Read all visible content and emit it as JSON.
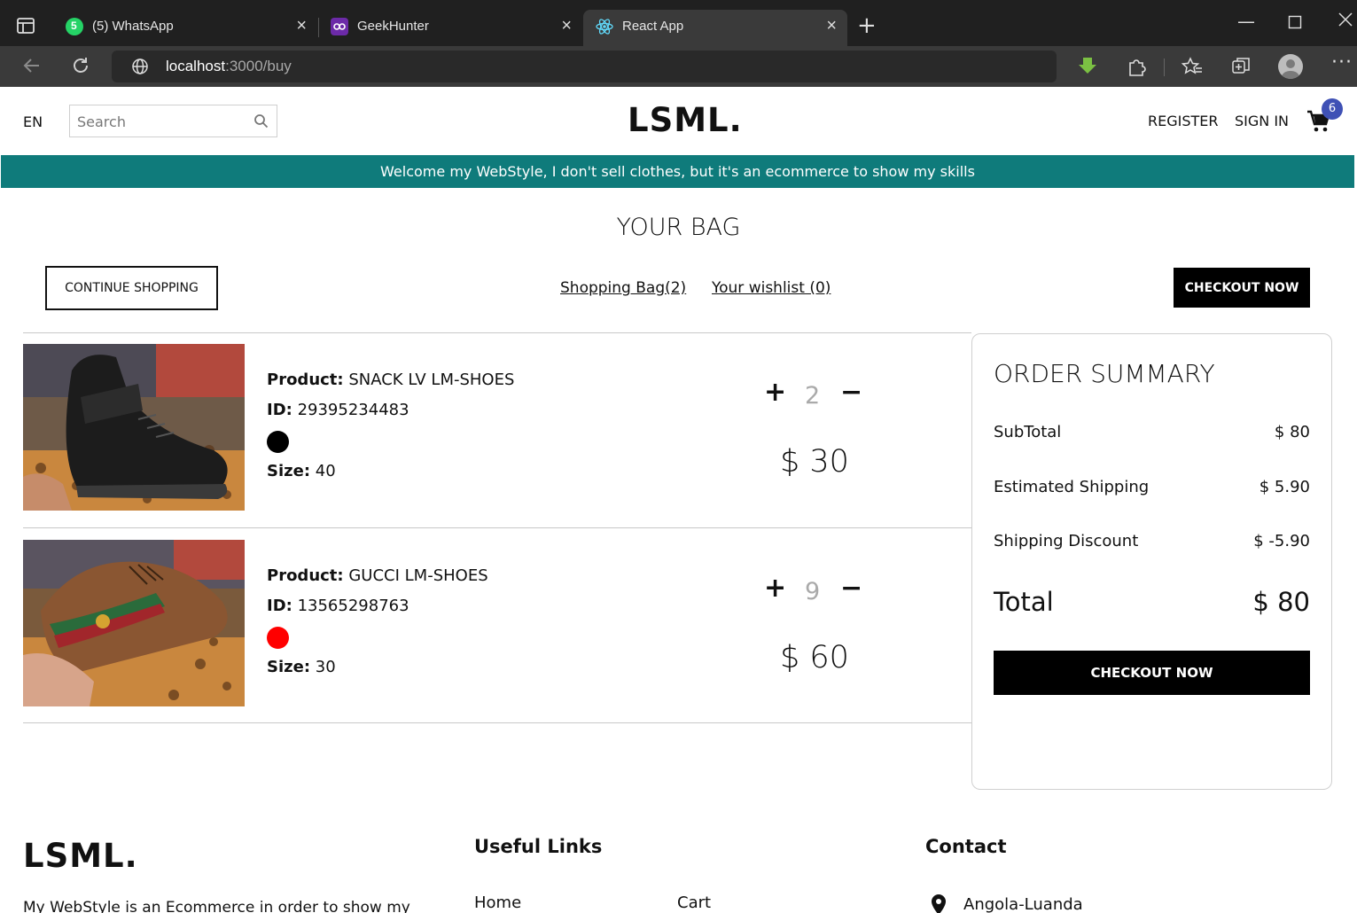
{
  "browser": {
    "tabs": [
      {
        "title": "(5) WhatsApp",
        "badge": "5"
      },
      {
        "title": "GeekHunter"
      },
      {
        "title": "React App"
      }
    ],
    "url_host": "localhost",
    "url_path": ":3000/buy"
  },
  "header": {
    "lang": "EN",
    "search_placeholder": "Search",
    "logo": "LSML.",
    "register": "REGISTER",
    "signin": "SIGN IN",
    "cart_count": "6"
  },
  "announcement": "Welcome my WebStyle, I don't sell clothes, but it's an ecommerce to show my skills",
  "bag": {
    "title": "YOUR BAG",
    "continue": "CONTINUE SHOPPING",
    "shopping_bag": "Shopping Bag(2)",
    "wishlist": "Your wishlist (0)",
    "checkout": "CHECKOUT NOW",
    "labels": {
      "product": "Product:",
      "id": "ID:",
      "size": "Size:"
    },
    "products": [
      {
        "name": "SNACK LV LM-SHOES",
        "id": "29395234483",
        "color": "#000000",
        "size": "40",
        "qty": "2",
        "price": "$ 30"
      },
      {
        "name": "GUCCI LM-SHOES",
        "id": "13565298763",
        "color": "#ff0000",
        "size": "30",
        "qty": "9",
        "price": "$ 60"
      }
    ]
  },
  "summary": {
    "title": "ORDER SUMMARY",
    "subtotal_label": "SubTotal",
    "subtotal": "$ 80",
    "shipping_label": "Estimated Shipping",
    "shipping": "$ 5.90",
    "discount_label": "Shipping Discount",
    "discount": "$ -5.90",
    "total_label": "Total",
    "total": "$ 80",
    "checkout": "CHECKOUT NOW"
  },
  "footer": {
    "logo": "LSML.",
    "description": "My WebStyle is an Ecommerce in order to show my",
    "links_title": "Useful Links",
    "links": [
      "Home",
      "Cart"
    ],
    "contact_title": "Contact",
    "address": "Angola-Luanda"
  }
}
